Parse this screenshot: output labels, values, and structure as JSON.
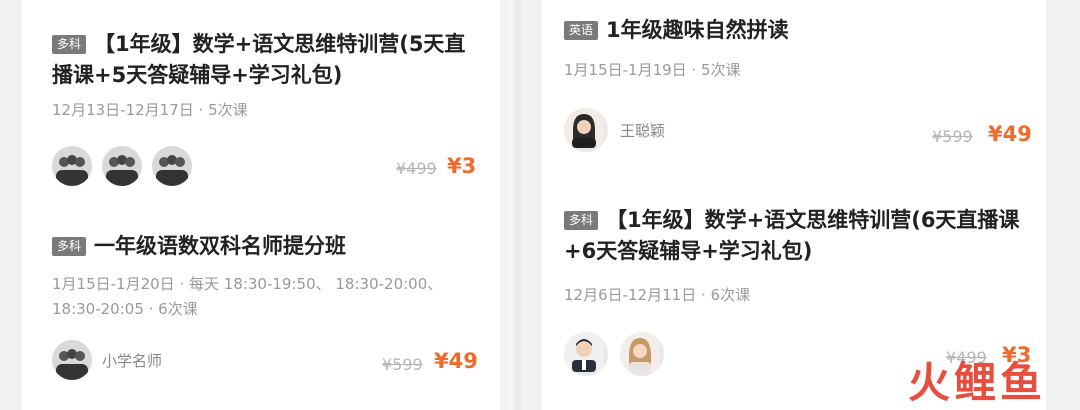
{
  "left": {
    "card1": {
      "tag": "多科",
      "title": "【1年级】数学+语文思维特训营(5天直播课+5天答疑辅导+学习礼包)",
      "meta": "12月13日-12月17日 · 5次课",
      "original_price": "¥499",
      "price": "¥3"
    },
    "card2": {
      "tag": "多科",
      "title": "一年级语数双科名师提分班",
      "meta": "1月15日-1月20日 · 每天 18:30-19:50、 18:30-20:00、 18:30-20:05 · 6次课",
      "teacher": "小学名师",
      "original_price": "¥599",
      "price": "¥49"
    }
  },
  "right": {
    "card1": {
      "tag": "英语",
      "title": "1年级趣味自然拼读",
      "meta": "1月15日-1月19日 · 5次课",
      "teacher": "王聪颖",
      "original_price": "¥599",
      "price": "¥49"
    },
    "card2": {
      "tag": "多科",
      "title": "【1年级】数学+语文思维特训营(6天直播课+6天答疑辅导+学习礼包)",
      "meta": "12月6日-12月11日 · 6次课",
      "original_price": "¥499",
      "price": "¥3"
    }
  },
  "watermark": "火鲤鱼",
  "colors": {
    "price": "#f06a2a",
    "tag_bg": "#7a7a7a",
    "watermark": "#e53b2a"
  }
}
